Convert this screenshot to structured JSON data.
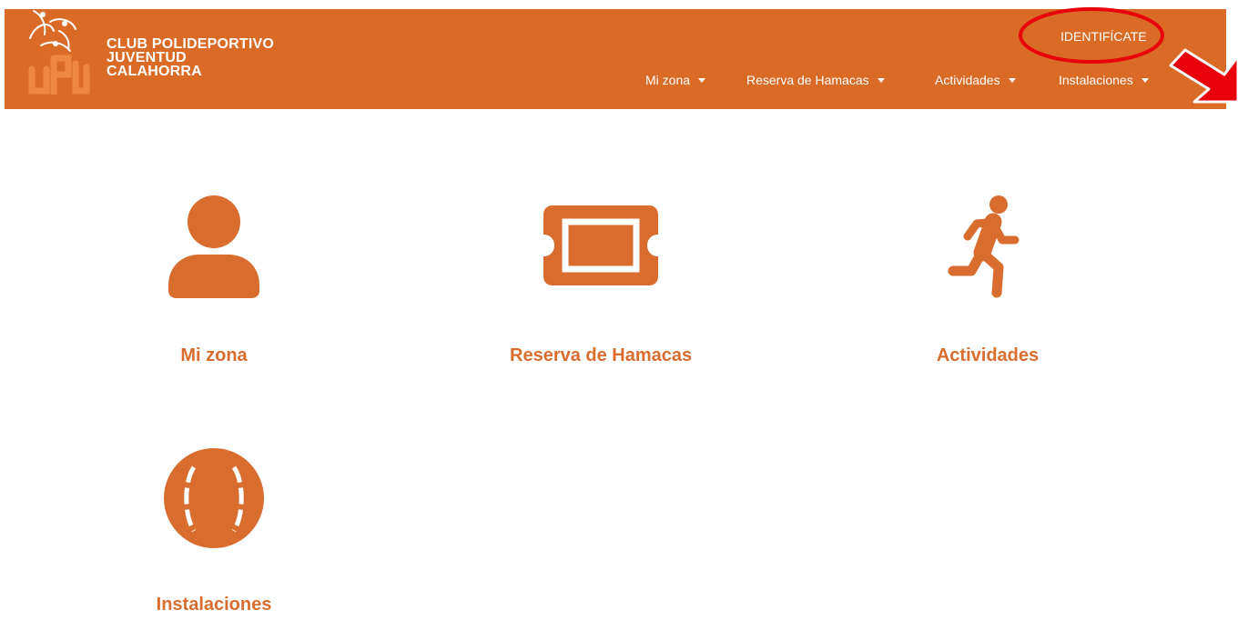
{
  "header": {
    "logo_lines": [
      "CLUB POLIDEPORTIVO",
      "JUVENTUD",
      "CALAHORRA"
    ],
    "login_label": "IDENTIFÍCATE",
    "menu": [
      {
        "label": "Mi zona"
      },
      {
        "label": "Reserva de Hamacas"
      },
      {
        "label": "Actividades"
      },
      {
        "label": "Instalaciones"
      }
    ]
  },
  "tiles": [
    {
      "label": "Mi zona",
      "icon": "user-icon"
    },
    {
      "label": "Reserva de Hamacas",
      "icon": "ticket-icon"
    },
    {
      "label": "Actividades",
      "icon": "running-icon"
    },
    {
      "label": "Instalaciones",
      "icon": "tennis-ball-icon"
    }
  ],
  "colors": {
    "navbar": "#da6b26",
    "accent": "#d86d2f",
    "annotation": "#e8000b"
  }
}
